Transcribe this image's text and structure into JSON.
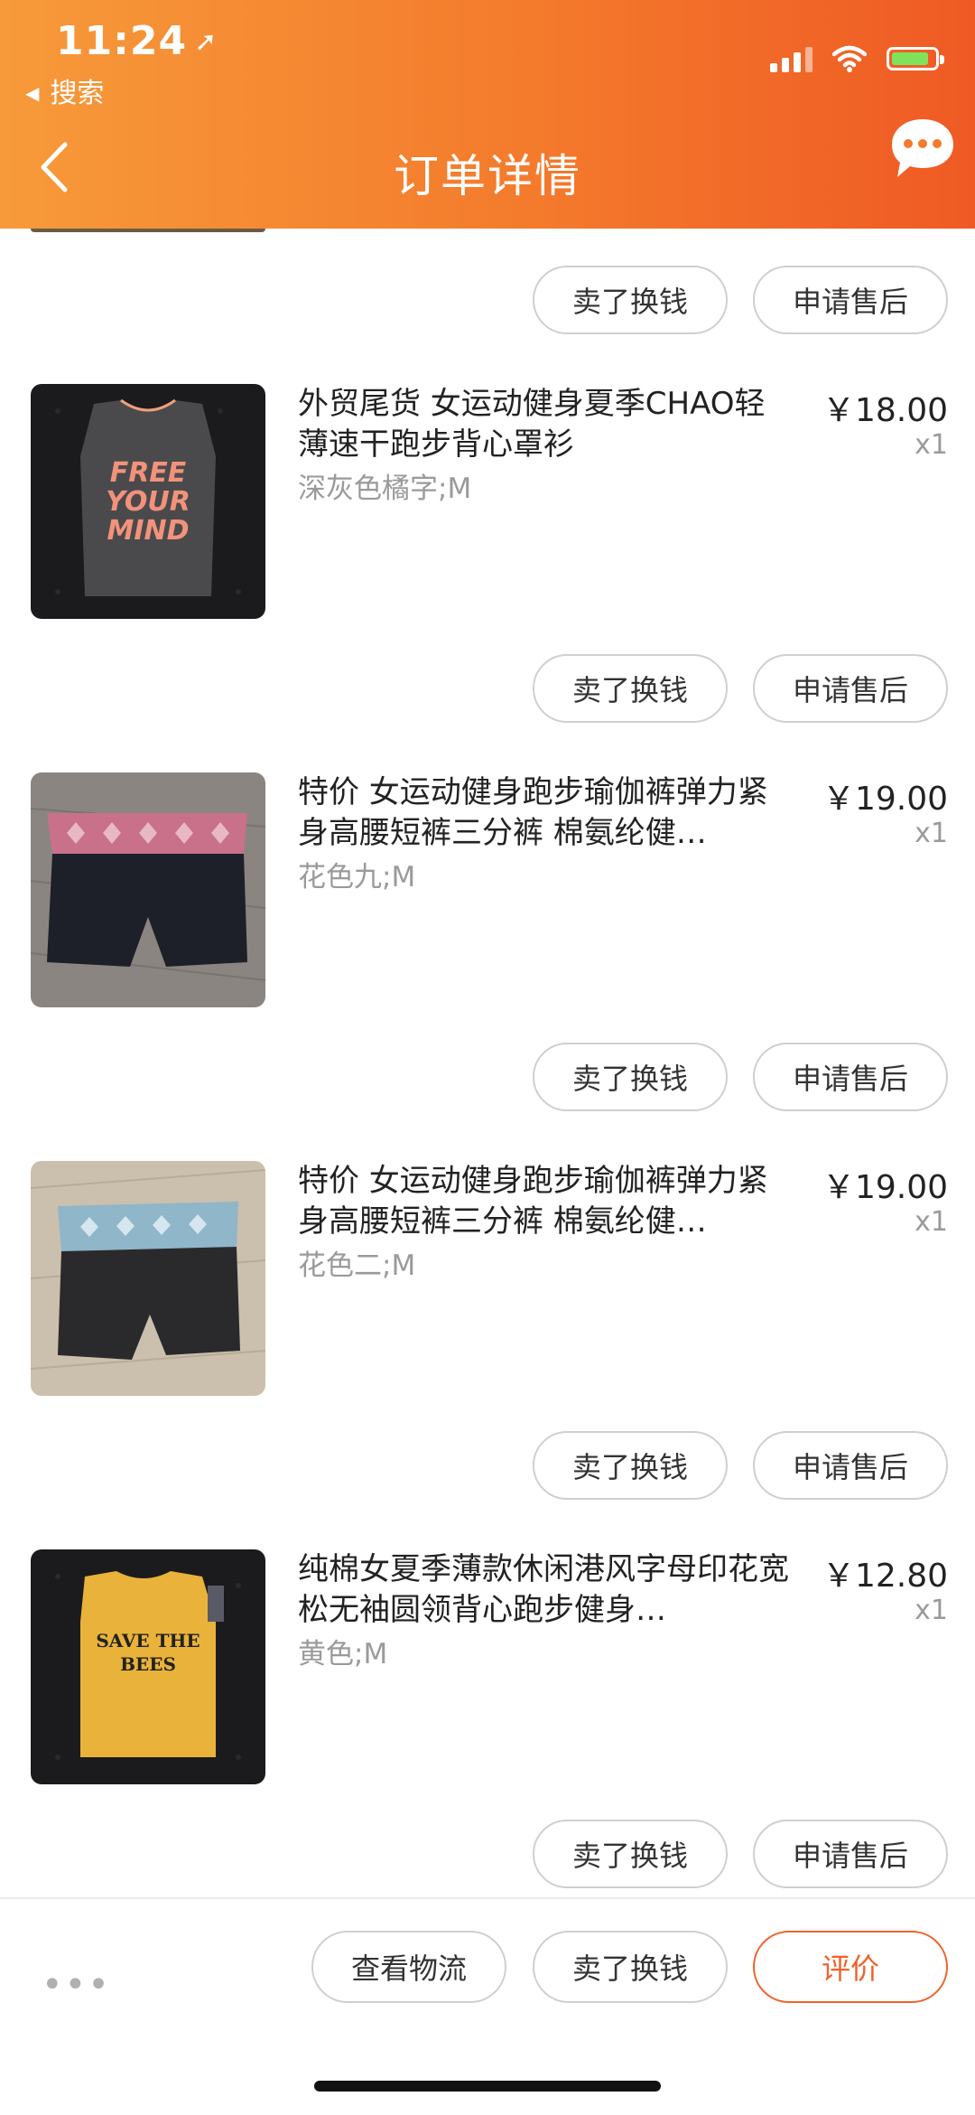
{
  "status_bar": {
    "time": "11:24",
    "back_app": "搜索"
  },
  "header": {
    "title": "订单详情"
  },
  "items": [
    {
      "title": "外贸尾货 女运动健身夏季CHAO轻薄速干跑步背心罩衫",
      "sku": "深灰色橘字;M",
      "price": "￥18.00",
      "qty": "x1",
      "print_text": "FREE YOUR MIND"
    },
    {
      "title": "特价 女运动健身跑步瑜伽裤弹力紧身高腰短裤三分裤 棉氨纶健…",
      "sku": "花色九;M",
      "price": "￥19.00",
      "qty": "x1"
    },
    {
      "title": "特价 女运动健身跑步瑜伽裤弹力紧身高腰短裤三分裤 棉氨纶健…",
      "sku": "花色二;M",
      "price": "￥19.00",
      "qty": "x1"
    },
    {
      "title": "纯棉女夏季薄款休闲港风字母印花宽松无袖圆领背心跑步健身…",
      "sku": "黄色;M",
      "price": "￥12.80",
      "qty": "x1",
      "print_text": "SAVE THE BEES"
    }
  ],
  "actions": {
    "sell": "卖了换钱",
    "after_sale": "申请售后"
  },
  "bottom_bar": {
    "more": "•••",
    "logistics": "查看物流",
    "sell": "卖了换钱",
    "review": "评价"
  },
  "colors": {
    "header_start": "#f79a3a",
    "header_end": "#ef5a24",
    "review_accent": "#f0622a"
  }
}
